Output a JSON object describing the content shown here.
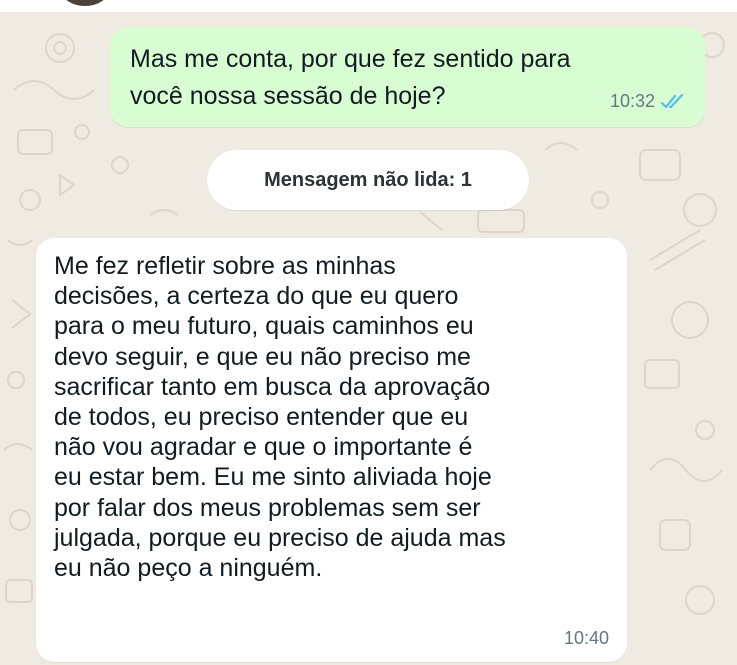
{
  "chat": {
    "outgoing_message": {
      "lines": [
        "Mas me conta, por que fez sentido para",
        "você nossa sessão de hoje?"
      ],
      "time": "10:32",
      "status_icon": "double-check-read-icon",
      "status_color": "#53bdeb"
    },
    "unread_divider": {
      "label": "Mensagem não lida: 1"
    },
    "incoming_message": {
      "lines": [
        "Me fez refletir sobre as minhas",
        "decisões, a certeza do que eu quero",
        "para o meu futuro, quais caminhos eu",
        "devo seguir, e que eu não preciso me",
        "sacrificar tanto em busca da aprovação",
        "de todos, eu preciso entender que eu",
        "não vou agradar e que o importante é",
        "eu estar bem. Eu me sinto aliviada hoje",
        "por falar dos meus problemas sem ser",
        "julgada, porque eu preciso de ajuda mas",
        "eu não peço a ninguém."
      ],
      "time": "10:40"
    }
  },
  "colors": {
    "wallpaper": "#efeae2",
    "outgoing_bubble": "#d9fdd3",
    "incoming_bubble": "#ffffff",
    "text": "#111b21",
    "meta_text": "#667781"
  }
}
